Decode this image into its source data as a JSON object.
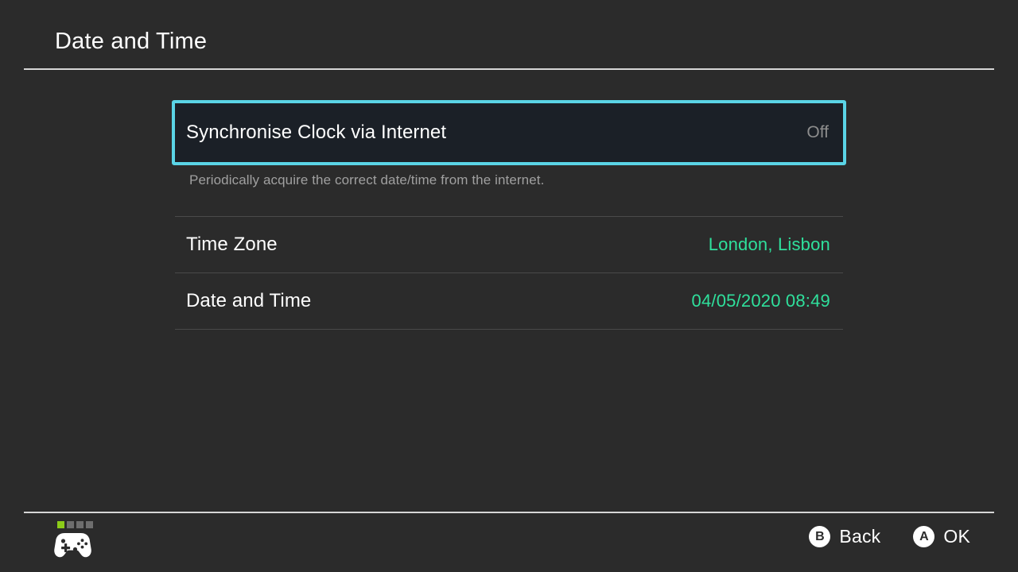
{
  "header": {
    "title": "Date and Time"
  },
  "settings": {
    "focused_row": {
      "label": "Synchronise Clock via Internet",
      "value": "Off",
      "description": "Periodically acquire the correct date/time from the internet."
    },
    "rows": [
      {
        "label": "Time Zone",
        "value": "London, Lisbon"
      },
      {
        "label": "Date and Time",
        "value": "04/05/2020 08:49"
      }
    ]
  },
  "footer": {
    "controller": {
      "icon": "gamepad-icon",
      "player_leds": [
        true,
        false,
        false,
        false
      ]
    },
    "hints": [
      {
        "glyph": "B",
        "label": "Back"
      },
      {
        "glyph": "A",
        "label": "OK"
      }
    ]
  },
  "colors": {
    "background": "#2b2b2b",
    "focus_border": "#5ad4e6",
    "focus_fill": "#1b2027",
    "value_accent": "#2fe09c",
    "muted_text": "#8d8d8d",
    "description_text": "#a0a0a0",
    "divider": "#d6d6d6",
    "led_active": "#8ccc19"
  }
}
